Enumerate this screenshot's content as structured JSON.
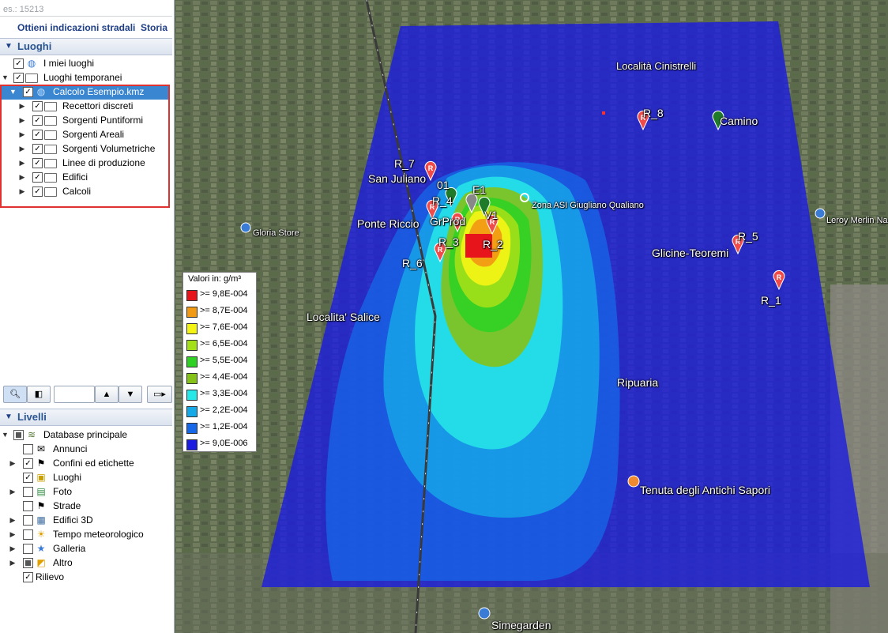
{
  "search": {
    "hint": "es.: 15213"
  },
  "links": {
    "directions": "Ottieni indicazioni stradali",
    "history": "Storia"
  },
  "places_panel": {
    "title": "Luoghi",
    "items": [
      {
        "label": "I miei luoghi",
        "icon": "globe-icon"
      },
      {
        "label": "Luoghi temporanei",
        "icon": "folder-open-icon"
      },
      {
        "label": "Calcolo Esempio.kmz",
        "icon": "globe-icon"
      },
      {
        "label": "Recettori discreti",
        "icon": "folder-icon"
      },
      {
        "label": "Sorgenti Puntiformi",
        "icon": "folder-icon"
      },
      {
        "label": "Sorgenti Areali",
        "icon": "folder-icon"
      },
      {
        "label": "Sorgenti Volumetriche",
        "icon": "folder-icon"
      },
      {
        "label": "Linee di produzione",
        "icon": "folder-icon"
      },
      {
        "label": "Edifici",
        "icon": "folder-icon"
      },
      {
        "label": "Calcoli",
        "icon": "folder-icon"
      }
    ]
  },
  "layers_panel": {
    "title": "Livelli",
    "items": [
      {
        "label": "Database principale",
        "icon": "layers-icon"
      },
      {
        "label": "Annunci",
        "icon": "envelope-icon"
      },
      {
        "label": "Confini ed etichette",
        "icon": "flag-icon"
      },
      {
        "label": "Luoghi",
        "icon": "image-icon"
      },
      {
        "label": "Foto",
        "icon": "photo-icon"
      },
      {
        "label": "Strade",
        "icon": "flag-icon"
      },
      {
        "label": "Edifici 3D",
        "icon": "cube-icon"
      },
      {
        "label": "Tempo meteorologico",
        "icon": "sun-icon"
      },
      {
        "label": "Galleria",
        "icon": "star-icon"
      },
      {
        "label": "Altro",
        "icon": "square-icon"
      },
      {
        "label": "Rilievo",
        "icon": ""
      }
    ]
  },
  "legend": {
    "title": "Valori in: g/m³",
    "entries": [
      {
        "label": ">= 9,8E-004",
        "color": "#e8141b"
      },
      {
        "label": ">= 8,7E-004",
        "color": "#f39a14"
      },
      {
        "label": ">= 7,6E-004",
        "color": "#f4f414"
      },
      {
        "label": ">= 6,5E-004",
        "color": "#a3e01a"
      },
      {
        "label": ">= 5,5E-004",
        "color": "#2fd224"
      },
      {
        "label": ">= 4,4E-004",
        "color": "#84c218"
      },
      {
        "label": ">= 3,3E-004",
        "color": "#27e8e8"
      },
      {
        "label": ">= 2,2E-004",
        "color": "#16a9e8"
      },
      {
        "label": ">= 1,2E-004",
        "color": "#1668e8"
      },
      {
        "label": ">= 9,0E-006",
        "color": "#1c1ce0"
      }
    ]
  },
  "map_labels": {
    "cinistrelli": "Località Cinistrelli",
    "r8": "R_8",
    "camino": "Camino",
    "r7": "R_7",
    "san_juliano": "San Juliano",
    "l01": "01",
    "e1": "E1",
    "r4": "R_4",
    "zona_asi": "Zona ASI Giugliano Qualiano",
    "grprod": "GrProd",
    "v1": "V1",
    "ponte_riccio": "Ponte Riccio",
    "gloria_store": "Gloria Store",
    "r3": "R_3",
    "r2": "R_2",
    "r5": "R_5",
    "glicine": "Glicine-Teoremi",
    "leroy": "Leroy Merlin Na",
    "r6": "R_6",
    "r1": "R_1",
    "salice": "Localita' Salice",
    "ripuaria": "Ripuaria",
    "tenuta": "Tenuta degli Antichi Sapori",
    "simegarden": "Simegarden"
  }
}
